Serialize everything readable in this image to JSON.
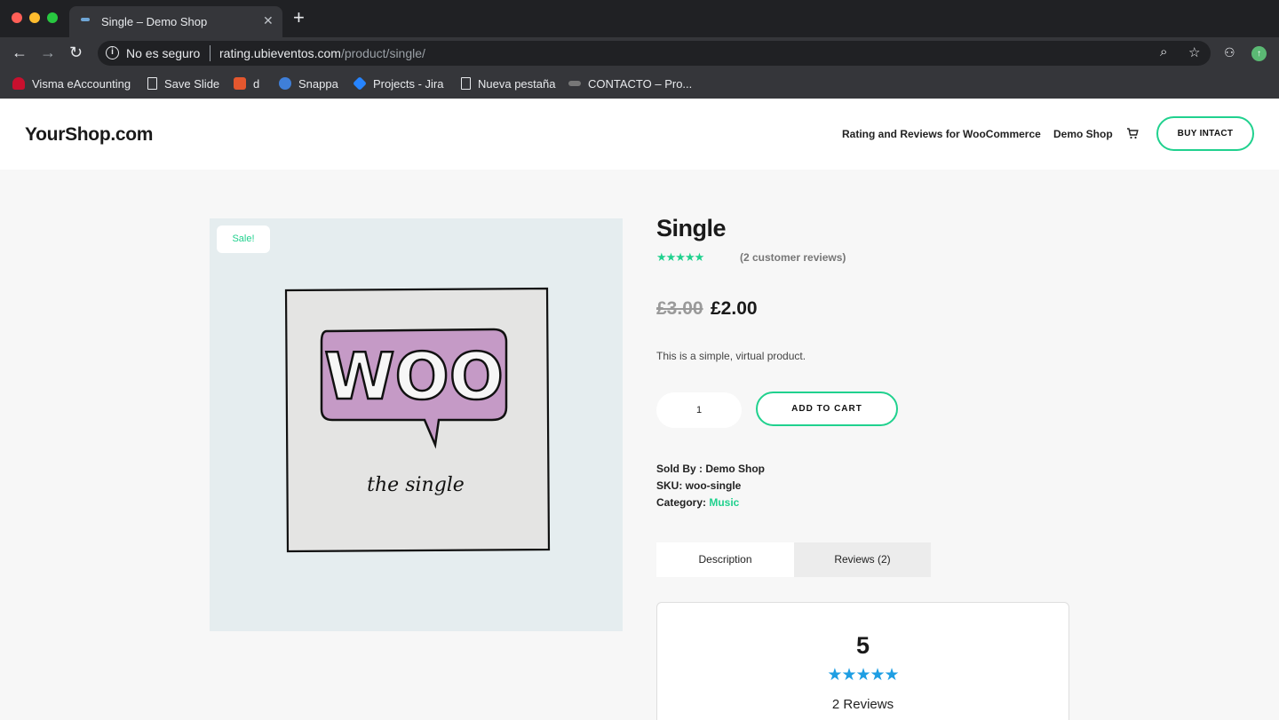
{
  "browser": {
    "tab_title": "Single – Demo Shop",
    "tab_close": "✕",
    "new_tab": "+",
    "security_label": "No es seguro",
    "url_host": "rating.ubieventos.com",
    "url_path": "/product/single/",
    "bookmarks": [
      {
        "label": "Visma eAccounting",
        "icon": "visma-icon",
        "color": "#c8102e"
      },
      {
        "label": "Save Slide",
        "icon": "page-icon",
        "color": ""
      },
      {
        "label": "d",
        "icon": "d-icon",
        "color": "#e4572e"
      },
      {
        "label": "Snappa",
        "icon": "snappa-icon",
        "color": "#3f7fd9"
      },
      {
        "label": "Projects - Jira",
        "icon": "jira-icon",
        "color": "#2684ff"
      },
      {
        "label": "Nueva pestaña",
        "icon": "page-icon",
        "color": ""
      },
      {
        "label": "CONTACTO – Pro...",
        "icon": "contact-icon",
        "color": "#777777"
      }
    ]
  },
  "header": {
    "logo": "YourShop.com",
    "nav": [
      "Rating and Reviews for WooCommerce",
      "Demo Shop"
    ],
    "buy_button": "BUY INTACT"
  },
  "product": {
    "sale_badge": "Sale!",
    "image_text_main": "WOO",
    "image_text_sub": "the single",
    "title": "Single",
    "rating_stars": "★★★★★",
    "review_count": "(2 customer reviews)",
    "price_old": "£3.00",
    "price_new": "£2.00",
    "short_description": "This is a simple, virtual product.",
    "quantity": "1",
    "add_to_cart": "ADD TO CART",
    "sold_by": "Sold By : Demo Shop",
    "sku": "SKU: woo-single",
    "category_label": "Category: ",
    "category_value": "Music"
  },
  "tabs": {
    "description": "Description",
    "reviews": "Reviews (2)"
  },
  "rating_summary": {
    "average": "5",
    "stars": "★★★★★",
    "total": "2 Reviews"
  },
  "colors": {
    "accent": "#20d18e",
    "star_blue": "#1e9ee3"
  }
}
